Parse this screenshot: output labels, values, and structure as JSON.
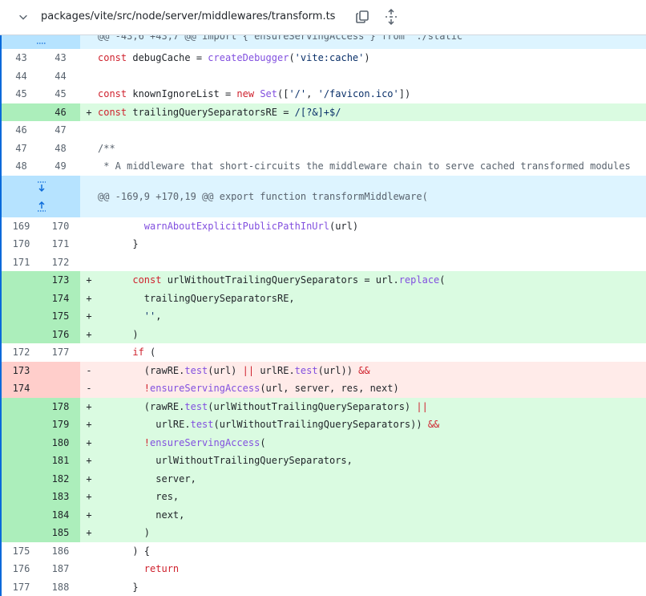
{
  "header": {
    "file_path": "packages/vite/src/node/server/middlewares/transform.ts"
  },
  "hunk_top": {
    "text": "@@ -43,6 +43,7 @@ import { ensureServingAccess } from './static"
  },
  "rows_a": [
    {
      "type": "ctx",
      "old": "43",
      "new": "43",
      "sign": "",
      "code": [
        [
          "kw",
          "const "
        ],
        [
          "",
          "debugCache = "
        ],
        [
          "fn",
          "createDebugger"
        ],
        [
          "",
          "("
        ],
        [
          "str",
          "'vite:cache'"
        ],
        [
          "",
          ")"
        ]
      ]
    },
    {
      "type": "ctx",
      "old": "44",
      "new": "44",
      "sign": "",
      "code": []
    },
    {
      "type": "ctx",
      "old": "45",
      "new": "45",
      "sign": "",
      "code": [
        [
          "kw",
          "const "
        ],
        [
          "",
          "knownIgnoreList = "
        ],
        [
          "kw",
          "new "
        ],
        [
          "fn",
          "Set"
        ],
        [
          "",
          "(["
        ],
        [
          "str",
          "'/'"
        ],
        [
          "",
          ", "
        ],
        [
          "str",
          "'/favicon.ico'"
        ],
        [
          "",
          "])"
        ]
      ]
    },
    {
      "type": "add",
      "old": "",
      "new": "46",
      "sign": "+",
      "code": [
        [
          "kw",
          "const "
        ],
        [
          "",
          "trailingQuerySeparatorsRE = "
        ],
        [
          "str",
          "/[?&]+$/"
        ]
      ]
    },
    {
      "type": "ctx",
      "old": "46",
      "new": "47",
      "sign": "",
      "code": []
    },
    {
      "type": "ctx",
      "old": "47",
      "new": "48",
      "sign": "",
      "code": [
        [
          "cm",
          "/**"
        ]
      ]
    },
    {
      "type": "ctx",
      "old": "48",
      "new": "49",
      "sign": "",
      "code": [
        [
          "cm",
          " * A middleware that short-circuits the middleware chain to serve cached transformed modules"
        ]
      ]
    }
  ],
  "hunk": {
    "text": "@@ -169,9 +170,19 @@ export function transformMiddleware("
  },
  "rows_b": [
    {
      "type": "ctx",
      "old": "169",
      "new": "170",
      "sign": "",
      "code": [
        [
          "",
          "        "
        ],
        [
          "fn",
          "warnAboutExplicitPublicPathInUrl"
        ],
        [
          "",
          "(url)"
        ]
      ]
    },
    {
      "type": "ctx",
      "old": "170",
      "new": "171",
      "sign": "",
      "code": [
        [
          "",
          "      }"
        ]
      ]
    },
    {
      "type": "ctx",
      "old": "171",
      "new": "172",
      "sign": "",
      "code": []
    },
    {
      "type": "add",
      "old": "",
      "new": "173",
      "sign": "+",
      "code": [
        [
          "",
          "      "
        ],
        [
          "kw",
          "const "
        ],
        [
          "",
          "urlWithoutTrailingQuerySeparators = url."
        ],
        [
          "fn",
          "replace"
        ],
        [
          "",
          "("
        ]
      ]
    },
    {
      "type": "add",
      "old": "",
      "new": "174",
      "sign": "+",
      "code": [
        [
          "",
          "        trailingQuerySeparatorsRE,"
        ]
      ]
    },
    {
      "type": "add",
      "old": "",
      "new": "175",
      "sign": "+",
      "code": [
        [
          "",
          "        "
        ],
        [
          "str",
          "''"
        ],
        [
          "",
          ","
        ]
      ]
    },
    {
      "type": "add",
      "old": "",
      "new": "176",
      "sign": "+",
      "code": [
        [
          "",
          "      )"
        ]
      ]
    },
    {
      "type": "ctx",
      "old": "172",
      "new": "177",
      "sign": "",
      "code": [
        [
          "",
          "      "
        ],
        [
          "kw",
          "if"
        ],
        [
          "",
          " ("
        ]
      ]
    },
    {
      "type": "del",
      "old": "173",
      "new": "",
      "sign": "-",
      "code": [
        [
          "",
          "        (rawRE."
        ],
        [
          "fn",
          "test"
        ],
        [
          "",
          "(url) "
        ],
        [
          "kw",
          "||"
        ],
        [
          "",
          " urlRE."
        ],
        [
          "fn",
          "test"
        ],
        [
          "",
          "(url)) "
        ],
        [
          "kw",
          "&&"
        ]
      ]
    },
    {
      "type": "del",
      "old": "174",
      "new": "",
      "sign": "-",
      "code": [
        [
          "",
          "        "
        ],
        [
          "kw",
          "!"
        ],
        [
          "fn",
          "ensureServingAccess"
        ],
        [
          "",
          "(url, server, res, next)"
        ]
      ]
    },
    {
      "type": "add",
      "old": "",
      "new": "178",
      "sign": "+",
      "code": [
        [
          "",
          "        (rawRE."
        ],
        [
          "fn",
          "test"
        ],
        [
          "",
          "(urlWithoutTrailingQuerySeparators) "
        ],
        [
          "kw",
          "||"
        ]
      ]
    },
    {
      "type": "add",
      "old": "",
      "new": "179",
      "sign": "+",
      "code": [
        [
          "",
          "          urlRE."
        ],
        [
          "fn",
          "test"
        ],
        [
          "",
          "(urlWithoutTrailingQuerySeparators)) "
        ],
        [
          "kw",
          "&&"
        ]
      ]
    },
    {
      "type": "add",
      "old": "",
      "new": "180",
      "sign": "+",
      "code": [
        [
          "",
          "        "
        ],
        [
          "kw",
          "!"
        ],
        [
          "fn",
          "ensureServingAccess"
        ],
        [
          "",
          "("
        ]
      ]
    },
    {
      "type": "add",
      "old": "",
      "new": "181",
      "sign": "+",
      "code": [
        [
          "",
          "          urlWithoutTrailingQuerySeparators,"
        ]
      ]
    },
    {
      "type": "add",
      "old": "",
      "new": "182",
      "sign": "+",
      "code": [
        [
          "",
          "          server,"
        ]
      ]
    },
    {
      "type": "add",
      "old": "",
      "new": "183",
      "sign": "+",
      "code": [
        [
          "",
          "          res,"
        ]
      ]
    },
    {
      "type": "add",
      "old": "",
      "new": "184",
      "sign": "+",
      "code": [
        [
          "",
          "          next,"
        ]
      ]
    },
    {
      "type": "add",
      "old": "",
      "new": "185",
      "sign": "+",
      "code": [
        [
          "",
          "        )"
        ]
      ]
    },
    {
      "type": "ctx",
      "old": "175",
      "new": "186",
      "sign": "",
      "code": [
        [
          "",
          "      ) {"
        ]
      ]
    },
    {
      "type": "ctx",
      "old": "176",
      "new": "187",
      "sign": "",
      "code": [
        [
          "",
          "        "
        ],
        [
          "kw",
          "return"
        ]
      ]
    },
    {
      "type": "ctx",
      "old": "177",
      "new": "188",
      "sign": "",
      "code": [
        [
          "",
          "      }"
        ]
      ]
    }
  ],
  "colors": {
    "add_bg": "#dafbe1",
    "add_gutter": "#aceebb",
    "del_bg": "#ffebe9",
    "del_gutter": "#ffcecb",
    "hunk_bg": "#ddf4ff",
    "hunk_gutter": "#b6e3ff",
    "keyword": "#cf222e",
    "function": "#8250df",
    "string": "#0a3069"
  },
  "icons": [
    "chevron-down-icon",
    "copy-icon",
    "unfold-icon",
    "expand-up-icon",
    "expand-down-icon"
  ]
}
